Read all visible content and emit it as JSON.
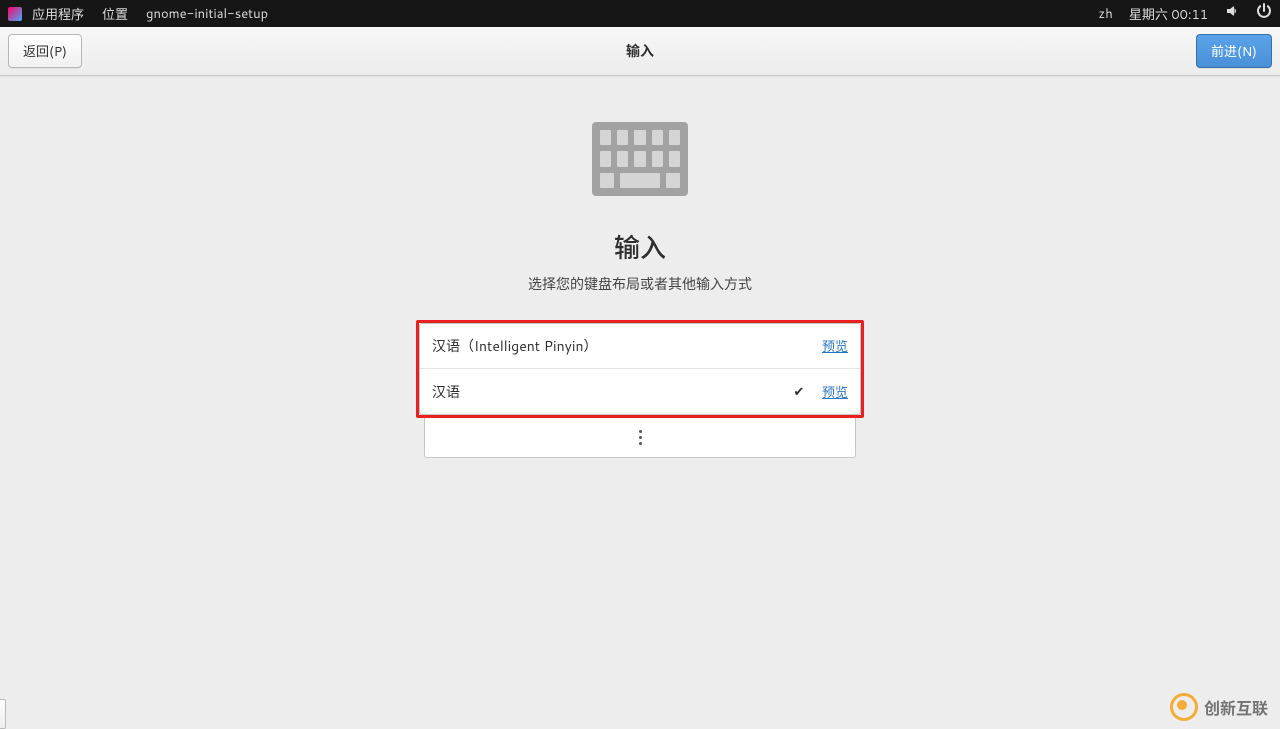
{
  "topbar": {
    "applications": "应用程序",
    "places": "位置",
    "appname": "gnome-initial-setup",
    "input_indicator": "zh",
    "datetime": "星期六 00:11"
  },
  "headerbar": {
    "back_label": "返回(P)",
    "title": "输入",
    "next_label": "前进(N)"
  },
  "page": {
    "heading": "输入",
    "subtitle": "选择您的键盘布局或者其他输入方式",
    "options": [
      {
        "label": "汉语（Intelligent Pinyin）",
        "selected": false,
        "preview": "预览"
      },
      {
        "label": "汉语",
        "selected": true,
        "preview": "预览"
      }
    ]
  },
  "watermark": {
    "text": "创新互联"
  }
}
